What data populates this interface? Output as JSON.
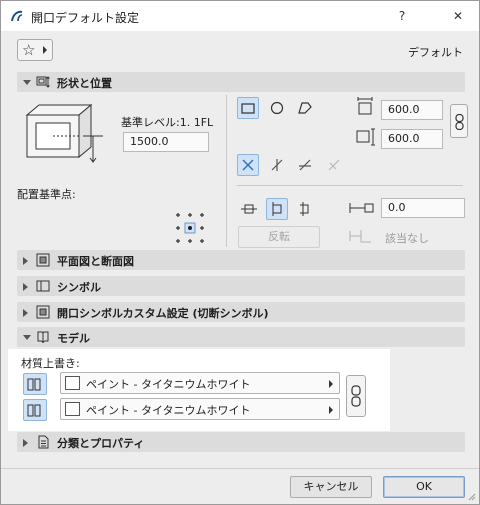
{
  "window": {
    "title": "開口デフォルト設定",
    "help_label": "?",
    "close_label": "✕"
  },
  "top": {
    "favorites_icon": "star-icon",
    "default_label": "デフォルト"
  },
  "sections": {
    "shape": {
      "label": "形状と位置",
      "expanded": true
    },
    "plan": {
      "label": "平面図と断面図",
      "expanded": false
    },
    "symbol": {
      "label": "シンボル",
      "expanded": false
    },
    "opening_custom": {
      "label": "開口シンボルカスタム設定 (切断シンボル)",
      "expanded": false
    },
    "model": {
      "label": "モデル",
      "expanded": true
    },
    "classification": {
      "label": "分類とプロパティ",
      "expanded": false
    }
  },
  "shape": {
    "reference_level_label": "基準レベル:1. 1FL",
    "reference_level_value": "1500.0",
    "anchor_label": "配置基準点:",
    "width_value": "600.0",
    "height_value": "600.0",
    "offset_value": "0.0",
    "flip_label": "反転",
    "not_applicable_label": "該当なし"
  },
  "model": {
    "override_label": "材質上書き:",
    "material_1": "ペイント - タイタニウムホワイト",
    "material_2": "ペイント - タイタニウムホワイト"
  },
  "footer": {
    "cancel_label": "キャンセル",
    "ok_label": "OK"
  },
  "colors": {
    "selected_bg": "#cfe2f6",
    "accent": "#2f6db5"
  }
}
